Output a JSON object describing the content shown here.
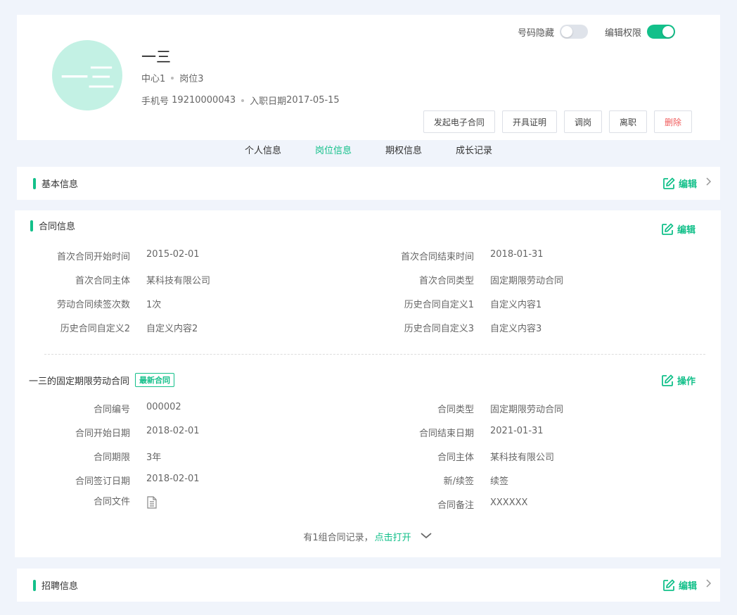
{
  "profile": {
    "avatar_text": "一三",
    "name": "一三",
    "department": "中心1",
    "position": "岗位3",
    "phone_label": "手机号",
    "phone": "19210000043",
    "hire_label": "入职日期",
    "hire_date": "2017-05-15",
    "toggles": [
      {
        "label": "号码隐藏",
        "on": false
      },
      {
        "label": "编辑权限",
        "on": true
      }
    ],
    "actions": {
      "sign_contract": "发起电子合同",
      "certificate": "开具证明",
      "transfer": "调岗",
      "resign": "离职",
      "delete": "删除"
    }
  },
  "tabs": [
    {
      "label": "个人信息",
      "active": false
    },
    {
      "label": "岗位信息",
      "active": true
    },
    {
      "label": "期权信息",
      "active": false
    },
    {
      "label": "成长记录",
      "active": false
    }
  ],
  "basic": {
    "title": "基本信息",
    "edit_label": "编辑"
  },
  "contract": {
    "title": "合同信息",
    "edit_label": "编辑",
    "first": {
      "left": [
        {
          "k": "首次合同开始时间",
          "v": "2015-02-01"
        },
        {
          "k": "首次合同主体",
          "v": "某科技有限公司"
        },
        {
          "k": "劳动合同续签次数",
          "v": "1次"
        },
        {
          "k": "历史合同自定义2",
          "v": "自定义内容2"
        }
      ],
      "right": [
        {
          "k": "首次合同结束时间",
          "v": "2018-01-31"
        },
        {
          "k": "首次合同类型",
          "v": "固定期限劳动合同"
        },
        {
          "k": "历史合同自定义1",
          "v": "自定义内容1"
        },
        {
          "k": "历史合同自定义3",
          "v": "自定义内容3"
        }
      ]
    },
    "latest": {
      "title": "一三的固定期限劳动合同",
      "badge": "最新合同",
      "action_label": "操作",
      "left": [
        {
          "k": "合同编号",
          "v": "000002"
        },
        {
          "k": "合同开始日期",
          "v": "2018-02-01"
        },
        {
          "k": "合同期限",
          "v": "3年"
        },
        {
          "k": "合同签订日期",
          "v": "2018-02-01"
        },
        {
          "k": "合同文件",
          "v": ""
        }
      ],
      "right": [
        {
          "k": "合同类型",
          "v": "固定期限劳动合同"
        },
        {
          "k": "合同结束日期",
          "v": "2021-01-31"
        },
        {
          "k": "合同主体",
          "v": "某科技有限公司"
        },
        {
          "k": "新/续签",
          "v": "续签"
        },
        {
          "k": "合同备注",
          "v": "XXXXXX"
        }
      ]
    },
    "records_text": "有1组合同记录，",
    "records_open": "点击打开"
  },
  "recruit": {
    "title": "招聘信息",
    "edit_label": "编辑"
  },
  "colors": {
    "accent": "#13c08a",
    "danger": "#f05b5b",
    "avatar_bg": "#c3f1e4",
    "page_bg": "#f0f4fb"
  }
}
